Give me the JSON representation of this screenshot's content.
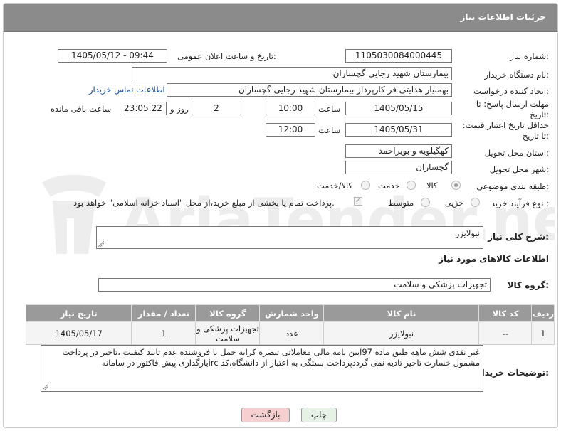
{
  "header": {
    "title": "جزئیات اطلاعات نیاز"
  },
  "form": {
    "need_number_label": "شماره نیاز:",
    "need_number": "1105030084000445",
    "announce_label": "تاریخ و ساعت اعلان عمومی:",
    "announce_value": "1405/05/12 - 09:44",
    "buyer_org_label": "نام دستگاه خریدار:",
    "buyer_org": "بیمارستان شهید رجایی گچساران",
    "creator_label": "ایجاد کننده درخواست:",
    "creator": "بهمنیار هدایتی فر کارپرداز بیمارستان شهید رجایی گچساران",
    "contact_link": "اطلاعات تماس خریدار",
    "deadline_label": "مهلت ارسال پاسخ: تا تاریخ:",
    "deadline_date": "1405/05/15",
    "hour_label": "ساعت",
    "deadline_time": "10:00",
    "days_value": "2",
    "days_label": "روز و",
    "remaining_time": "23:05:22",
    "remaining_label": "ساعت باقی مانده",
    "price_validity_label": "حداقل تاریخ اعتبار قیمت: تا تاریخ:",
    "price_validity_date": "1405/05/31",
    "price_validity_time": "12:00",
    "province_label": "استان محل تحویل:",
    "province": "کهگیلویه و بویراحمد",
    "city_label": "شهر محل تحویل:",
    "city": "گچساران",
    "category_label": "طبقه بندی موضوعی:",
    "category_options": [
      "کالا",
      "خدمت",
      "کالا/خدمت"
    ],
    "category_selected": "کالا",
    "process_label": "نوع فرآیند خرید :",
    "process_options": [
      "جزیی",
      "متوسط"
    ],
    "payment_note": "پرداخت تمام یا بخشی از مبلغ خرید،از محل \"اسناد خزانه اسلامی\" خواهد بود.",
    "summary_label": "شرح کلی نیاز:",
    "summary_value": "نبولایزر",
    "goods_info_title": "اطلاعات کالاهای مورد نیاز",
    "goods_group_label": "گروه کالا:",
    "goods_group": "تجهیزات پزشکی و سلامت",
    "buyer_notes_label": "توضیحات خریدار:",
    "buyer_notes": "غیر نقدی شش ماهه طبق ماده 97آیین نامه مالی معاملاتی تبصره کرایه حمل با فروشنده عدم تایید کیفیت ،تاخیر در پرداخت مشمول خسارت تاخیر تادیه نمی گرددپرداخت بستگی به اعتبار از دانشگاه،کد ircبارگذاری پیش فاکتور در سامانه"
  },
  "table": {
    "headers": [
      "ردیف",
      "کد کالا",
      "نام کالا",
      "واحد شمارش",
      "گروه کالا",
      "تعداد / مقدار",
      "تاریخ نیاز"
    ],
    "rows": [
      [
        "1",
        "--",
        "نبولایزر",
        "عدد",
        "تجهیزات پزشکی و سلامت",
        "1",
        "1405/05/17"
      ]
    ]
  },
  "buttons": {
    "print": "چاپ",
    "back": "بازگشت"
  },
  "watermark": {
    "text": "AriaTender.neT"
  },
  "colors": {
    "header_bg": "#8b8b8b",
    "table_header_bg": "#9a9a9a",
    "back_button_bg": "#f6d0d0",
    "print_button_bg": "#e6f2e6",
    "link": "#1a4fa3"
  }
}
